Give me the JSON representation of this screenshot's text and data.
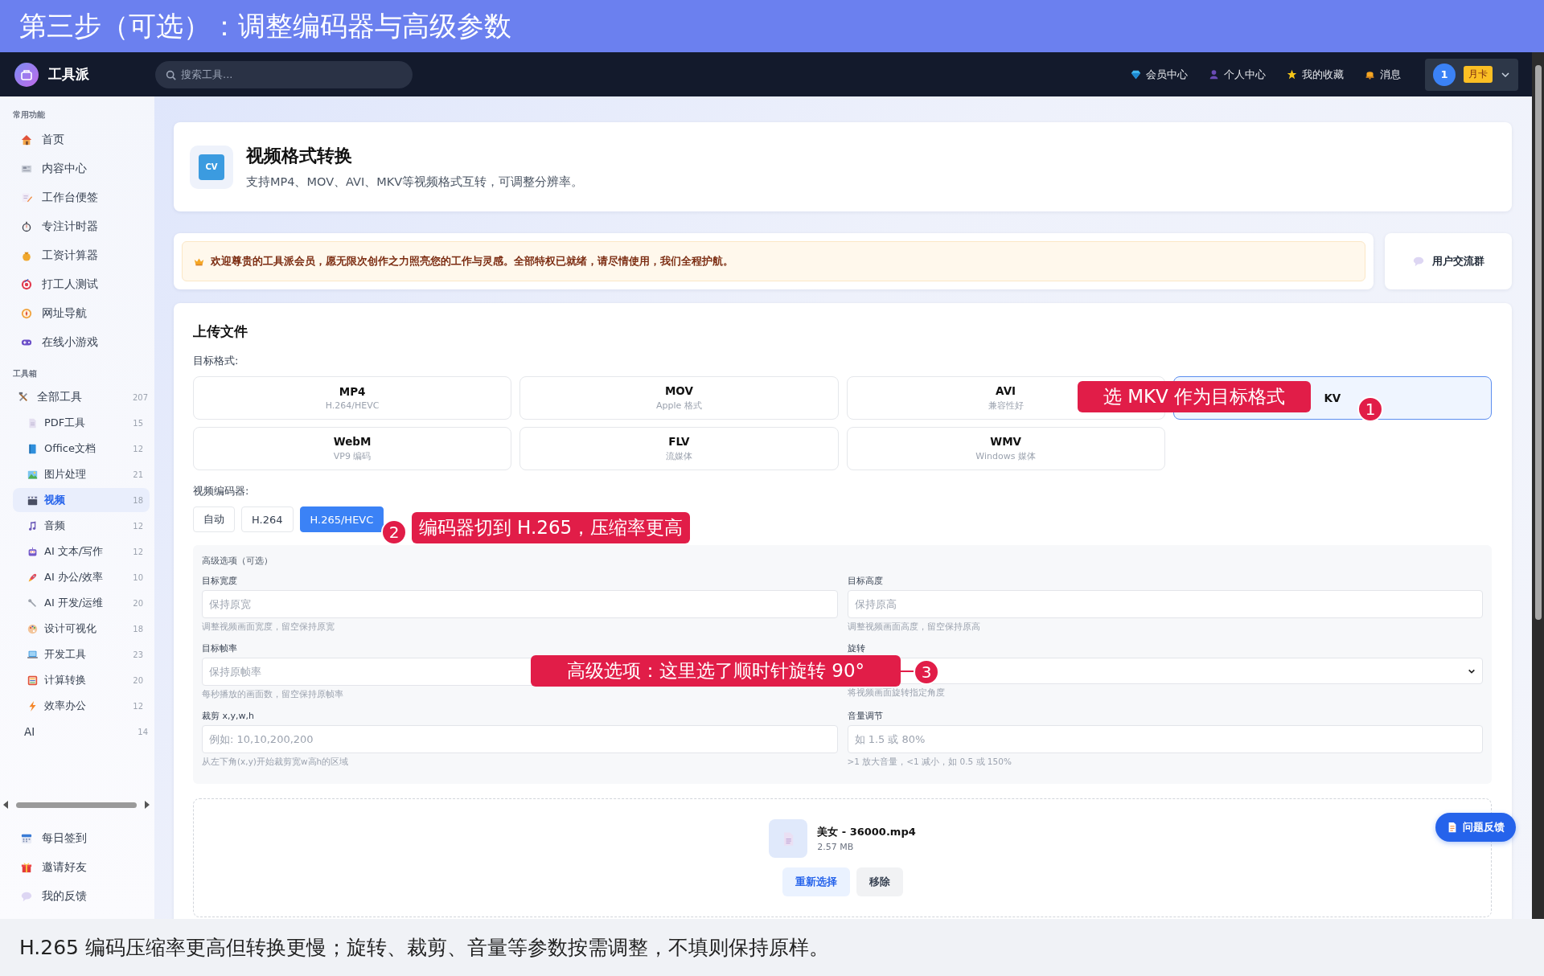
{
  "guide_title": "第三步（可选）：调整编码器与高级参数",
  "app": {
    "logo": "工具派",
    "search": {
      "placeholder": "搜索工具..."
    },
    "nav": [
      {
        "label": "会员中心"
      },
      {
        "label": "个人中心"
      },
      {
        "label": "我的收藏"
      },
      {
        "label": "消息"
      }
    ],
    "user": {
      "avatar": "1",
      "badge": "月卡"
    }
  },
  "sidebar": {
    "sections": [
      {
        "title": "常用功能",
        "items": [
          {
            "label": "首页",
            "selected": false
          },
          {
            "label": "内容中心",
            "selected": false
          },
          {
            "label": "工作台便签",
            "selected": false
          },
          {
            "label": "专注计时器",
            "selected": false
          },
          {
            "label": "工资计算器",
            "selected": false
          },
          {
            "label": "打工人测试",
            "selected": false
          },
          {
            "label": "网址导航",
            "selected": false
          },
          {
            "label": "在线小游戏",
            "selected": false
          }
        ]
      },
      {
        "title": "工具箱",
        "items": [
          {
            "label": "全部工具",
            "count": "207",
            "selected": false,
            "children": [
              {
                "label": "PDF工具",
                "count": "15",
                "selected": false
              },
              {
                "label": "Office文档",
                "count": "12",
                "selected": false
              },
              {
                "label": "图片处理",
                "count": "21",
                "selected": false
              },
              {
                "label": "视频",
                "count": "18",
                "selected": true
              },
              {
                "label": "音频",
                "count": "12",
                "selected": false
              },
              {
                "label": "AI 文本/写作",
                "count": "12",
                "selected": false
              },
              {
                "label": "AI 办公/效率",
                "count": "10",
                "selected": false
              },
              {
                "label": "AI 开发/运维",
                "count": "20",
                "selected": false
              },
              {
                "label": "设计可视化",
                "count": "18",
                "selected": false
              },
              {
                "label": "开发工具",
                "count": "23",
                "selected": false
              },
              {
                "label": "计算转换",
                "count": "20",
                "selected": false
              },
              {
                "label": "效率办公",
                "count": "12",
                "selected": false
              }
            ]
          },
          {
            "label": "AI",
            "count": "14",
            "selected": false
          }
        ]
      }
    ],
    "bottom_items": [
      {
        "label": "每日签到",
        "selected": false
      },
      {
        "label": "邀请好友",
        "selected": false
      },
      {
        "label": "我的反馈",
        "selected": false
      }
    ]
  },
  "tool": {
    "icon_text": "CV",
    "title": "视频格式转换",
    "description": "支持MP4、MOV、AVI、MKV等视频格式互转，可调整分辨率。"
  },
  "notice": {
    "text": "欢迎尊贵的工具派会员，愿无限次创作之力照亮您的工作与灵感。全部特权已就绪，请尽情使用，我们全程护航。",
    "side_button": "用户交流群"
  },
  "upload": {
    "title": "上传文件",
    "format_label": "目标格式:",
    "formats": [
      {
        "label": "MP4",
        "sub": "H.264/HEVC",
        "selected": false
      },
      {
        "label": "MOV",
        "sub": "Apple 格式",
        "selected": false
      },
      {
        "label": "AVI",
        "sub": "兼容性好",
        "selected": false
      },
      {
        "label": "KV",
        "selected": true
      },
      {
        "label": "WebM",
        "sub": "VP9 编码",
        "selected": false
      },
      {
        "label": "FLV",
        "sub": "流媒体",
        "selected": false
      },
      {
        "label": "WMV",
        "sub": "Windows 媒体",
        "selected": false
      }
    ],
    "encoder_label": "视频编码器:",
    "encoders": [
      {
        "label": "自动",
        "selected": false
      },
      {
        "label": "H.264",
        "selected": false
      },
      {
        "label": "H.265/HEVC",
        "selected": true
      }
    ],
    "advanced": {
      "title": "高级选项（可选）",
      "fields": [
        {
          "kind": "input",
          "label": "目标宽度",
          "placeholder": "保持原宽",
          "help": "调整视频画面宽度，留空保持原宽"
        },
        {
          "kind": "input",
          "label": "目标高度",
          "placeholder": "保持原高",
          "help": "调整视频画面高度，留空保持原高"
        },
        {
          "kind": "input",
          "label": "目标帧率",
          "placeholder": "保持原帧率",
          "help": "每秒播放的画面数，留空保持原帧率"
        },
        {
          "kind": "select",
          "label": "旋转",
          "help": "将视频画面旋转指定角度"
        },
        {
          "kind": "input",
          "label": "裁剪 x,y,w,h",
          "placeholder": "例如: 10,10,200,200",
          "help": "从左下角(x,y)开始裁剪宽w高h的区域"
        },
        {
          "kind": "input",
          "label": "音量调节",
          "placeholder": "如 1.5 或 80%",
          "help": ">1 放大音量，<1 减小，如 0.5 或 150%"
        }
      ]
    },
    "file": {
      "name": "美女 - 36000.mp4",
      "size": "2.57 MB",
      "actions": [
        {
          "label": "重新选择",
          "kind": "primary"
        },
        {
          "label": "移除",
          "kind": "secondary"
        }
      ]
    }
  },
  "feedback_button": "问题反馈",
  "callouts": [
    {
      "number": "1",
      "text": "选 MKV 作为目标格式"
    },
    {
      "number": "2",
      "text": "编码器切到 H.265，压缩率更高"
    },
    {
      "number": "3",
      "text": "高级选项：这里选了顺时针旋转 90°"
    }
  ],
  "caption": "H.265 编码压缩率更高但转换更慢；旋转、裁剪、音量等参数按需调整，不填则保持原样。"
}
